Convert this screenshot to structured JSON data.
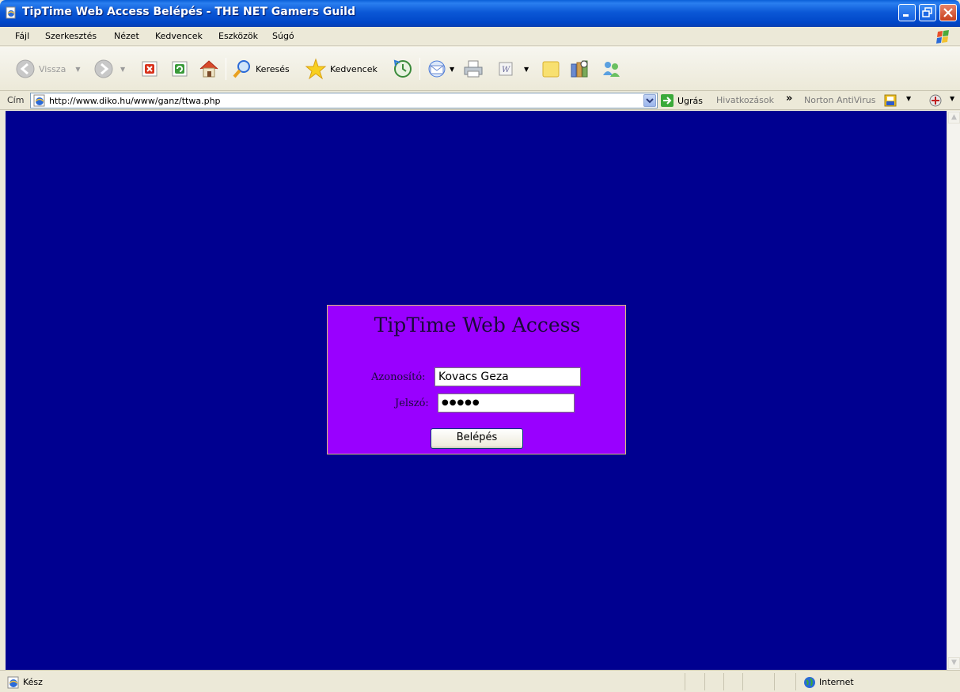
{
  "window": {
    "title": "TipTime Web Access Belépés - THE NET Gamers Guild"
  },
  "menu": {
    "items": [
      "Fájl",
      "Szerkesztés",
      "Nézet",
      "Kedvencek",
      "Eszközök",
      "Súgó"
    ]
  },
  "toolbar": {
    "back_label": "Vissza",
    "search_label": "Keresés",
    "favorites_label": "Kedvencek"
  },
  "address": {
    "label": "Cím",
    "url": "http://www.diko.hu/www/ganz/ttwa.php",
    "go_label": "Ugrás",
    "links_label": "Hivatkozások",
    "links_chevron": "»",
    "norton_label": "Norton AntiVirus"
  },
  "login": {
    "title": "TipTime Web Access",
    "username_label": "Azonosító:",
    "username_value": "Kovacs Geza",
    "password_label": "Jelszó:",
    "password_value": "●●●●●",
    "submit_label": "Belépés"
  },
  "status": {
    "text": "Kész",
    "zone": "Internet"
  },
  "colors": {
    "page_background": "#000090",
    "login_box": "#9900ff"
  }
}
